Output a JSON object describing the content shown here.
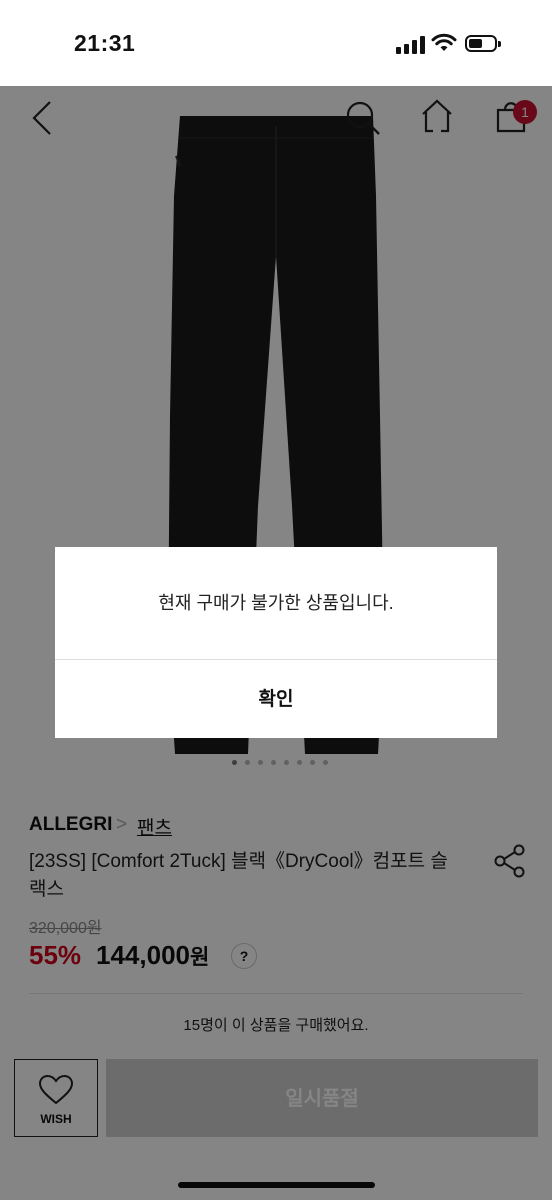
{
  "status_bar": {
    "time": "21:31"
  },
  "header": {
    "cart_count": "1"
  },
  "product": {
    "brand": "ALLEGRI",
    "breadcrumb_sep": ">",
    "category": "팬츠",
    "title": "[23SS] [Comfort 2Tuck] 블랙《DryCool》컴포트 슬랙스",
    "original_price": "320,000원",
    "discount": "55%",
    "price": "144,000",
    "price_unit": "원",
    "help": "?",
    "purchase_note": "15명이 이 상품을 구매했어요."
  },
  "bottom_bar": {
    "wish_label": "WISH",
    "buy_label": "일시품절"
  },
  "dialog": {
    "message": "현재 구매가 불가한 상품입니다.",
    "confirm_label": "확인"
  },
  "colors": {
    "discount": "#d0021b",
    "badge": "#c8102e",
    "overlay": "rgba(0,0,0,0.48)"
  }
}
